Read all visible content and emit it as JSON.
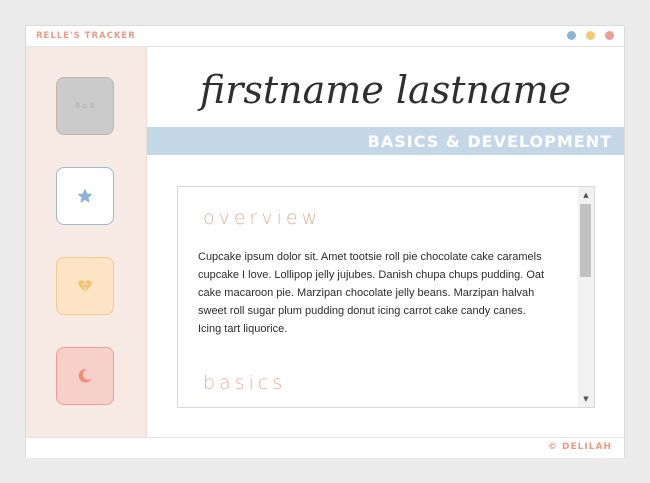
{
  "app": {
    "title": "RELLE'S TRACKER"
  },
  "window_controls": [
    "blue-dot",
    "yellow-dot",
    "red-dot"
  ],
  "sidebar": {
    "items": [
      {
        "icon": "grid-icon",
        "glyph": "⠿ ▫ ⠿"
      },
      {
        "icon": "star-icon"
      },
      {
        "icon": "heart-gem-icon"
      },
      {
        "icon": "moon-icon"
      }
    ]
  },
  "header": {
    "name": "firstname lastname",
    "banner": "BASICS & DEVELOPMENT"
  },
  "content": {
    "overview_heading": "overview",
    "overview_text": "Cupcake ipsum dolor sit. Amet tootsie roll pie chocolate cake caramels cupcake I love. Lollipop jelly jujubes. Danish chupa chups pudding. Oat cake macaroon pie. Marzipan chocolate jelly beans. Marzipan halvah sweet roll sugar plum pudding donut icing carrot cake candy canes. Icing tart liquorice.",
    "basics_heading": "basics"
  },
  "footer": {
    "credit": "© DELILAH"
  },
  "colors": {
    "accent": "#ec9a86",
    "banner": "#c3d7e6",
    "sidebar_bg": "#f7e9e3"
  }
}
